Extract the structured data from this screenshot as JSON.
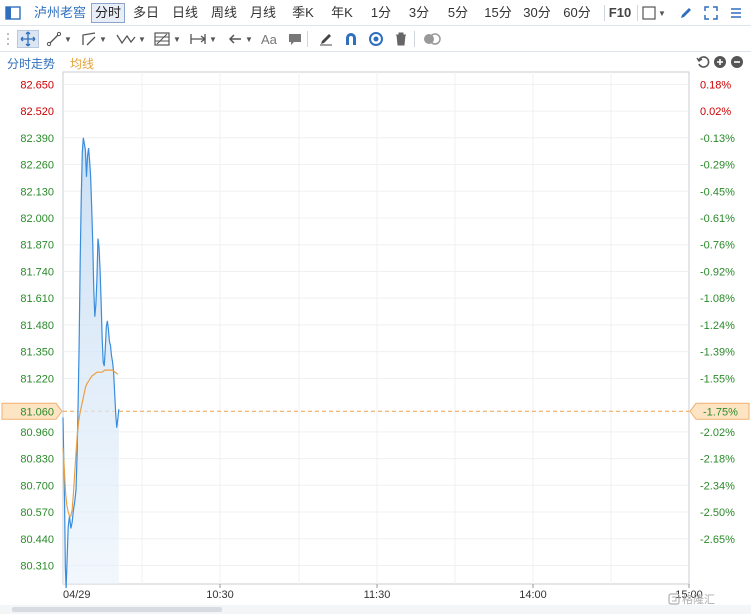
{
  "symbol": "泸州老窖",
  "periods": [
    {
      "label": "分时",
      "active": true
    },
    {
      "label": "多日",
      "active": false
    },
    {
      "label": "日线",
      "active": false
    },
    {
      "label": "周线",
      "active": false
    },
    {
      "label": "月线",
      "active": false
    },
    {
      "label": "季K",
      "active": false
    },
    {
      "label": "年K",
      "active": false
    },
    {
      "label": "1分",
      "active": false
    },
    {
      "label": "3分",
      "active": false
    },
    {
      "label": "5分",
      "active": false
    },
    {
      "label": "15分",
      "active": false
    },
    {
      "label": "30分",
      "active": false
    },
    {
      "label": "60分",
      "active": false
    }
  ],
  "f10_label": "F10",
  "draw_tools": {
    "text_tool_label": "Aa"
  },
  "legend": {
    "price_label": "分时走势",
    "avg_label": "均线"
  },
  "watermark": "格隆汇",
  "colors": {
    "price_line": "#3a8ddc",
    "avg_line": "#e8a045",
    "up": "#cc0000",
    "down": "#2a8a2a",
    "ref_line": "#f0a050",
    "ref_bg": "#fde5c4"
  },
  "chart_data": {
    "type": "line",
    "date_label": "04/29",
    "x_ticks": [
      "10:30",
      "11:30",
      "14:00",
      "15:00"
    ],
    "y_left_ticks": [
      "82.650",
      "82.520",
      "82.390",
      "82.260",
      "82.130",
      "82.000",
      "81.870",
      "81.740",
      "81.610",
      "81.480",
      "81.350",
      "81.220",
      "81.060",
      "80.960",
      "80.830",
      "80.700",
      "80.570",
      "80.440",
      "80.310"
    ],
    "y_right_ticks": [
      "0.18%",
      "0.02%",
      "-0.13%",
      "-0.29%",
      "-0.45%",
      "-0.61%",
      "-0.76%",
      "-0.92%",
      "-1.08%",
      "-1.24%",
      "-1.39%",
      "-1.55%",
      "-1.75%",
      "-2.02%",
      "-2.18%",
      "-2.34%",
      "-2.50%",
      "-2.65%"
    ],
    "ylim": [
      80.22,
      82.71
    ],
    "xlim_minutes": [
      0,
      240
    ],
    "reference_price": 81.06,
    "reference_pct": "-1.75%",
    "series": [
      {
        "key": "price",
        "name": "分时走势",
        "points": [
          [
            0,
            81.03
          ],
          [
            0.3,
            80.82
          ],
          [
            0.6,
            80.62
          ],
          [
            0.9,
            80.3
          ],
          [
            1.2,
            80.2
          ],
          [
            1.6,
            80.35
          ],
          [
            2,
            80.5
          ],
          [
            2.5,
            80.55
          ],
          [
            3,
            80.49
          ],
          [
            3.5,
            80.52
          ],
          [
            4,
            80.58
          ],
          [
            4.5,
            80.62
          ],
          [
            5,
            80.68
          ],
          [
            5.4,
            80.85
          ],
          [
            5.8,
            81.1
          ],
          [
            6.2,
            81.4
          ],
          [
            6.6,
            81.8
          ],
          [
            7,
            82.1
          ],
          [
            7.4,
            82.32
          ],
          [
            7.8,
            82.39
          ],
          [
            8.2,
            82.36
          ],
          [
            8.6,
            82.33
          ],
          [
            9,
            82.2
          ],
          [
            9.4,
            82.3
          ],
          [
            9.8,
            82.34
          ],
          [
            10.2,
            82.28
          ],
          [
            10.6,
            82.2
          ],
          [
            11,
            82.05
          ],
          [
            11.4,
            81.88
          ],
          [
            11.8,
            81.65
          ],
          [
            12.2,
            81.52
          ],
          [
            12.6,
            81.58
          ],
          [
            13,
            81.7
          ],
          [
            13.4,
            81.9
          ],
          [
            13.8,
            81.86
          ],
          [
            14.2,
            81.75
          ],
          [
            14.6,
            81.6
          ],
          [
            15,
            81.42
          ],
          [
            15.4,
            81.3
          ],
          [
            15.8,
            81.28
          ],
          [
            16.2,
            81.36
          ],
          [
            16.6,
            81.47
          ],
          [
            17,
            81.5
          ],
          [
            17.4,
            81.46
          ],
          [
            17.8,
            81.4
          ],
          [
            18.2,
            81.38
          ],
          [
            18.6,
            81.33
          ],
          [
            19,
            81.3
          ],
          [
            19.4,
            81.25
          ],
          [
            19.8,
            81.15
          ],
          [
            20.2,
            81.05
          ],
          [
            20.6,
            80.98
          ],
          [
            21,
            81.02
          ],
          [
            21.4,
            81.07
          ]
        ]
      },
      {
        "key": "avg",
        "name": "均线",
        "points": [
          [
            0,
            80.88
          ],
          [
            0.5,
            80.78
          ],
          [
            1,
            80.66
          ],
          [
            1.5,
            80.6
          ],
          [
            2,
            80.57
          ],
          [
            2.5,
            80.55
          ],
          [
            3,
            80.55
          ],
          [
            3.5,
            80.58
          ],
          [
            4,
            80.66
          ],
          [
            4.5,
            80.76
          ],
          [
            5,
            80.86
          ],
          [
            5.5,
            80.95
          ],
          [
            6,
            81.01
          ],
          [
            6.5,
            81.05
          ],
          [
            7,
            81.08
          ],
          [
            7.5,
            81.11
          ],
          [
            8,
            81.14
          ],
          [
            8.5,
            81.17
          ],
          [
            9,
            81.19
          ],
          [
            9.5,
            81.2
          ],
          [
            10,
            81.21
          ],
          [
            11,
            81.23
          ],
          [
            12,
            81.24
          ],
          [
            13,
            81.25
          ],
          [
            14,
            81.25
          ],
          [
            15,
            81.25
          ],
          [
            16,
            81.26
          ],
          [
            17,
            81.26
          ],
          [
            18,
            81.26
          ],
          [
            19,
            81.26
          ],
          [
            20,
            81.25
          ],
          [
            21,
            81.24
          ]
        ]
      }
    ]
  }
}
